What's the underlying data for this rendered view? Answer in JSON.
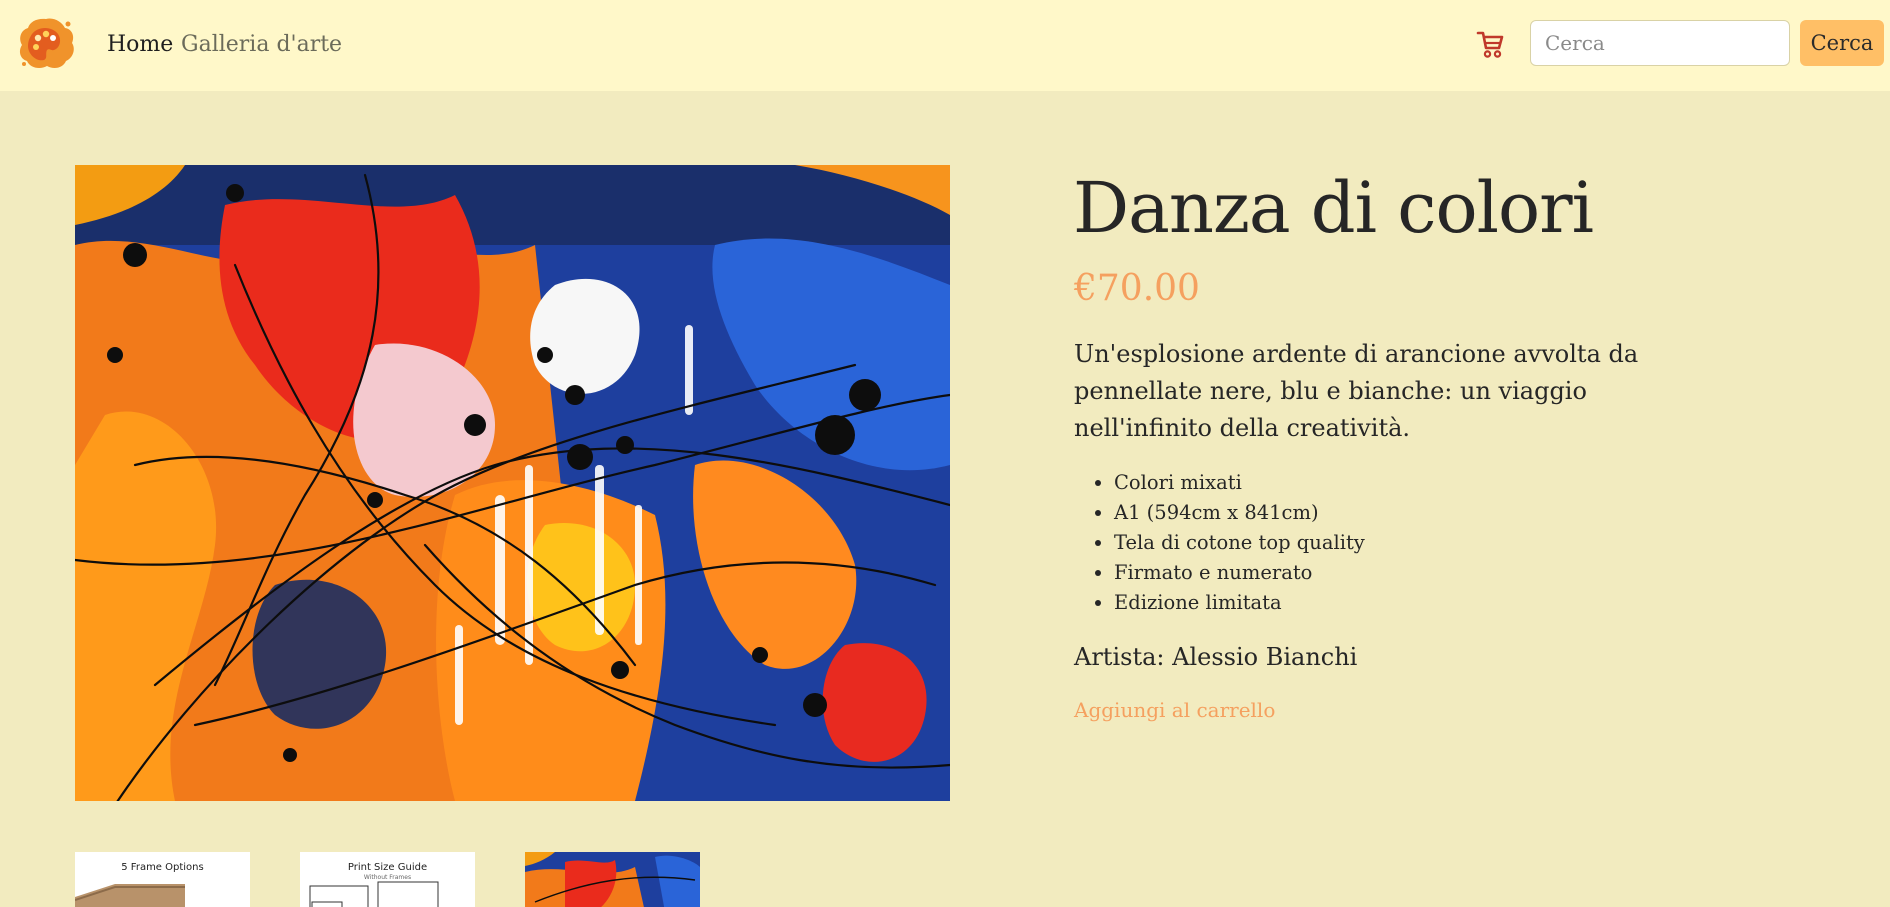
{
  "navbar": {
    "logo_icon": "palette-splash-icon",
    "home_label": "Home",
    "gallery_label": "Galleria d'arte",
    "cart_icon": "shopping-cart-icon",
    "search_placeholder": "Cerca",
    "search_value": "",
    "search_button_label": "Cerca"
  },
  "product": {
    "title": "Danza di colori",
    "price": "€70.00",
    "description": "Un'esplosione ardente di arancione avvolta da pennellate nere, blu e bianche: un viaggio nell'infinito della creatività.",
    "features": [
      "Colori mixati",
      "A1 (594cm x 841cm)",
      "Tela di cotone top quality",
      "Firmato e numerato",
      "Edizione limitata"
    ],
    "artist": "Artista: Alessio Bianchi",
    "add_to_cart_label": "Aggiungi al carrello"
  },
  "thumbnails": [
    {
      "title": "5 Frame Options",
      "subtitle": ""
    },
    {
      "title": "Print Size Guide",
      "subtitle": "Without Frames"
    },
    {
      "title": "",
      "subtitle": ""
    }
  ],
  "colors": {
    "page_bg": "#f2ebbf",
    "navbar_bg": "#fff8c9",
    "accent_orange": "#f5a05f",
    "button_bg": "#ffbf66",
    "cart_red": "#c0392b"
  }
}
